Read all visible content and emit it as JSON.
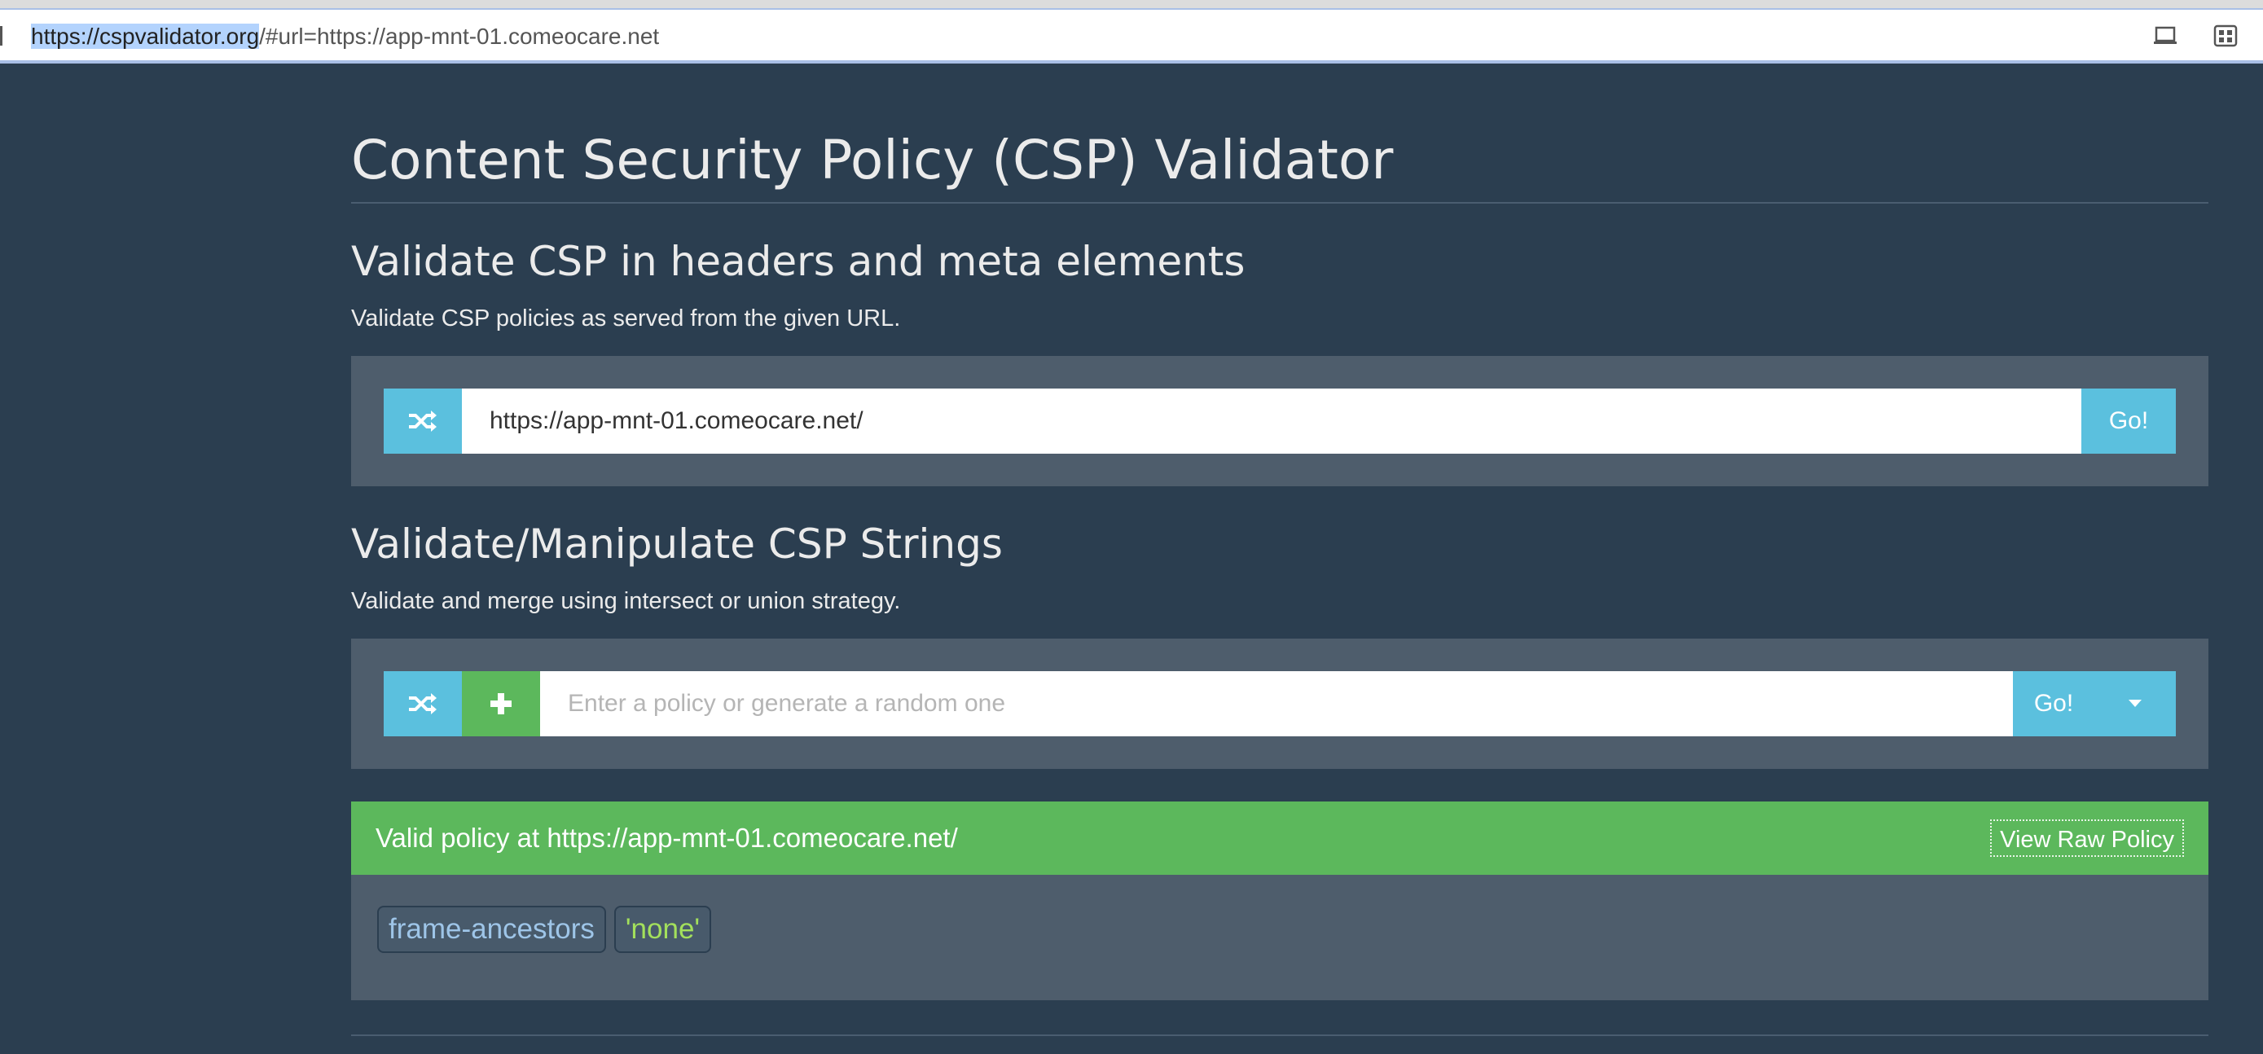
{
  "browser": {
    "url_host": "https://cspvalidator.org",
    "url_rest": "/#url=https://app-mnt-01.comeocare.net"
  },
  "page": {
    "title": "Content Security Policy (CSP) Validator"
  },
  "header_section": {
    "heading": "Validate CSP in headers and meta elements",
    "description": "Validate CSP policies as served from the given URL.",
    "url_value": "https://app-mnt-01.comeocare.net/",
    "go_label": "Go!"
  },
  "string_section": {
    "heading": "Validate/Manipulate CSP Strings",
    "description": "Validate and merge using intersect or union strategy.",
    "placeholder": "Enter a policy or generate a random one",
    "go_label": "Go!"
  },
  "result": {
    "title": "Valid policy at https://app-mnt-01.comeocare.net/",
    "raw_button": "View Raw Policy",
    "directive": "frame-ancestors",
    "value": "'none'"
  },
  "colors": {
    "background": "#2b3e50",
    "info": "#5bc0de",
    "success": "#5cb85c",
    "well": "#4e5d6c"
  },
  "icons": [
    "shuffle-icon",
    "plus-icon",
    "caret-down-icon",
    "cast-icon",
    "extensions-icon"
  ]
}
